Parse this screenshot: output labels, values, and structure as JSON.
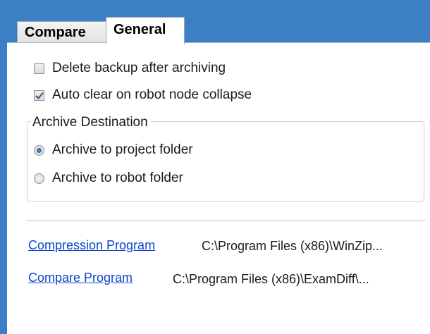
{
  "tabs": [
    {
      "label": "Compare",
      "active": false
    },
    {
      "label": "General",
      "active": true
    }
  ],
  "options": {
    "delete_backup": {
      "label": "Delete backup after archiving",
      "checked": false
    },
    "auto_clear": {
      "label": "Auto clear on robot node collapse",
      "checked": true
    }
  },
  "archive_destination": {
    "legend": "Archive Destination",
    "options": [
      {
        "label": "Archive to project folder",
        "selected": true
      },
      {
        "label": "Archive to robot folder",
        "selected": false
      }
    ]
  },
  "programs": {
    "compression": {
      "link": "Compression Program",
      "path": "C:\\Program Files (x86)\\WinZip..."
    },
    "compare": {
      "link": "Compare Program",
      "path": "C:\\Program Files (x86)\\ExamDiff\\..."
    }
  },
  "colors": {
    "accent": "#3d7fc4",
    "link": "#0b44cc"
  }
}
